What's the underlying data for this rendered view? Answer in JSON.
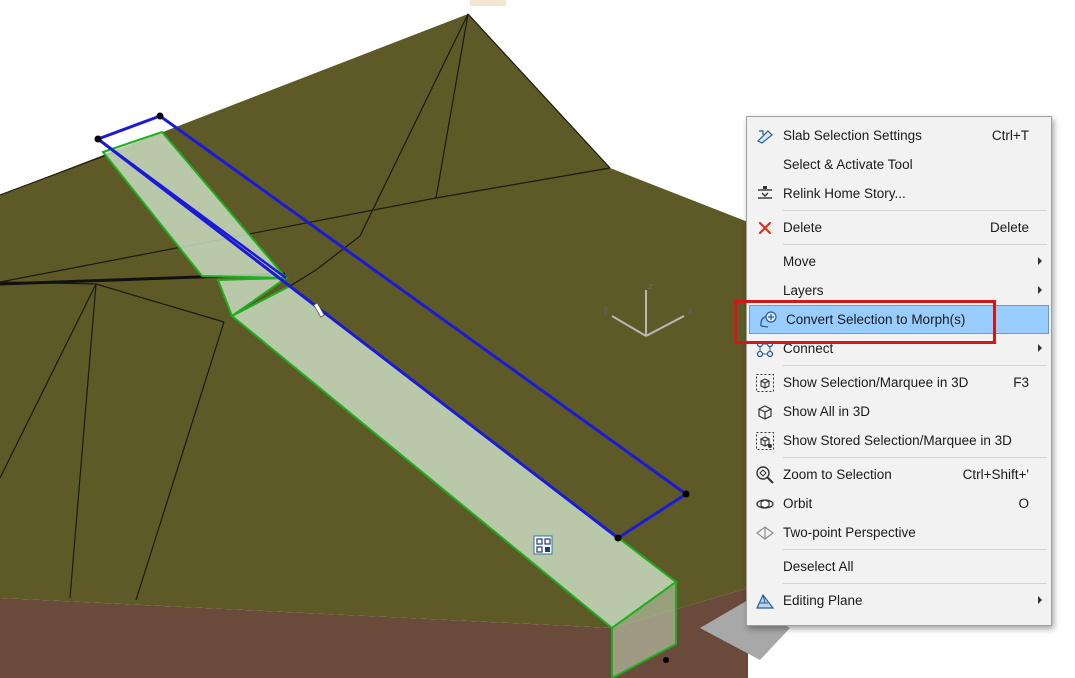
{
  "colors": {
    "terrain": "#5e5a28",
    "terrain_dark": "#4a4720",
    "soil_side": "#6a4a3a",
    "selection_outline": "#1a1ad8",
    "slab_edge": "#1fae1f",
    "slab_fill": "#c8dcc0",
    "menu_bg": "#f2f2f2",
    "menu_highlight": "#99ccff",
    "callout_box": "#d01818"
  },
  "scene": {
    "axis_labels": {
      "x": "x",
      "y": "y",
      "z": "z"
    }
  },
  "context_menu": {
    "items": [
      {
        "type": "item",
        "icon": "slab-settings-icon",
        "label": "Slab Selection Settings",
        "shortcut": "Ctrl+T"
      },
      {
        "type": "item",
        "icon": "",
        "label": "Select & Activate Tool",
        "shortcut": ""
      },
      {
        "type": "item",
        "icon": "relink-home-story-icon",
        "label": "Relink Home Story...",
        "shortcut": ""
      },
      {
        "type": "separator"
      },
      {
        "type": "item",
        "icon": "delete-icon",
        "label": "Delete",
        "shortcut": "Delete"
      },
      {
        "type": "separator"
      },
      {
        "type": "item",
        "icon": "",
        "label": "Move",
        "shortcut": "",
        "submenu": true
      },
      {
        "type": "item",
        "icon": "",
        "label": "Layers",
        "shortcut": "",
        "submenu": true
      },
      {
        "type": "item",
        "icon": "convert-to-morph-icon",
        "label": "Convert Selection to Morph(s)",
        "shortcut": "",
        "highlighted": true
      },
      {
        "type": "item",
        "icon": "connect-icon",
        "label": "Connect",
        "shortcut": "",
        "submenu": true
      },
      {
        "type": "separator"
      },
      {
        "type": "item",
        "icon": "show-selection-3d-icon",
        "label": "Show Selection/Marquee in 3D",
        "shortcut": "F3"
      },
      {
        "type": "item",
        "icon": "show-all-3d-icon",
        "label": "Show All in 3D",
        "shortcut": ""
      },
      {
        "type": "item",
        "icon": "show-stored-selection-3d-icon",
        "label": "Show Stored Selection/Marquee in 3D",
        "shortcut": ""
      },
      {
        "type": "separator"
      },
      {
        "type": "item",
        "icon": "zoom-to-selection-icon",
        "label": "Zoom to Selection",
        "shortcut": "Ctrl+Shift+'"
      },
      {
        "type": "item",
        "icon": "orbit-icon",
        "label": "Orbit",
        "shortcut": "O"
      },
      {
        "type": "item",
        "icon": "two-point-perspective-icon",
        "label": "Two-point Perspective",
        "shortcut": ""
      },
      {
        "type": "separator"
      },
      {
        "type": "item",
        "icon": "",
        "label": "Deselect All",
        "shortcut": ""
      },
      {
        "type": "separator"
      },
      {
        "type": "item",
        "icon": "editing-plane-icon",
        "label": "Editing Plane",
        "shortcut": "",
        "submenu": true
      }
    ]
  }
}
